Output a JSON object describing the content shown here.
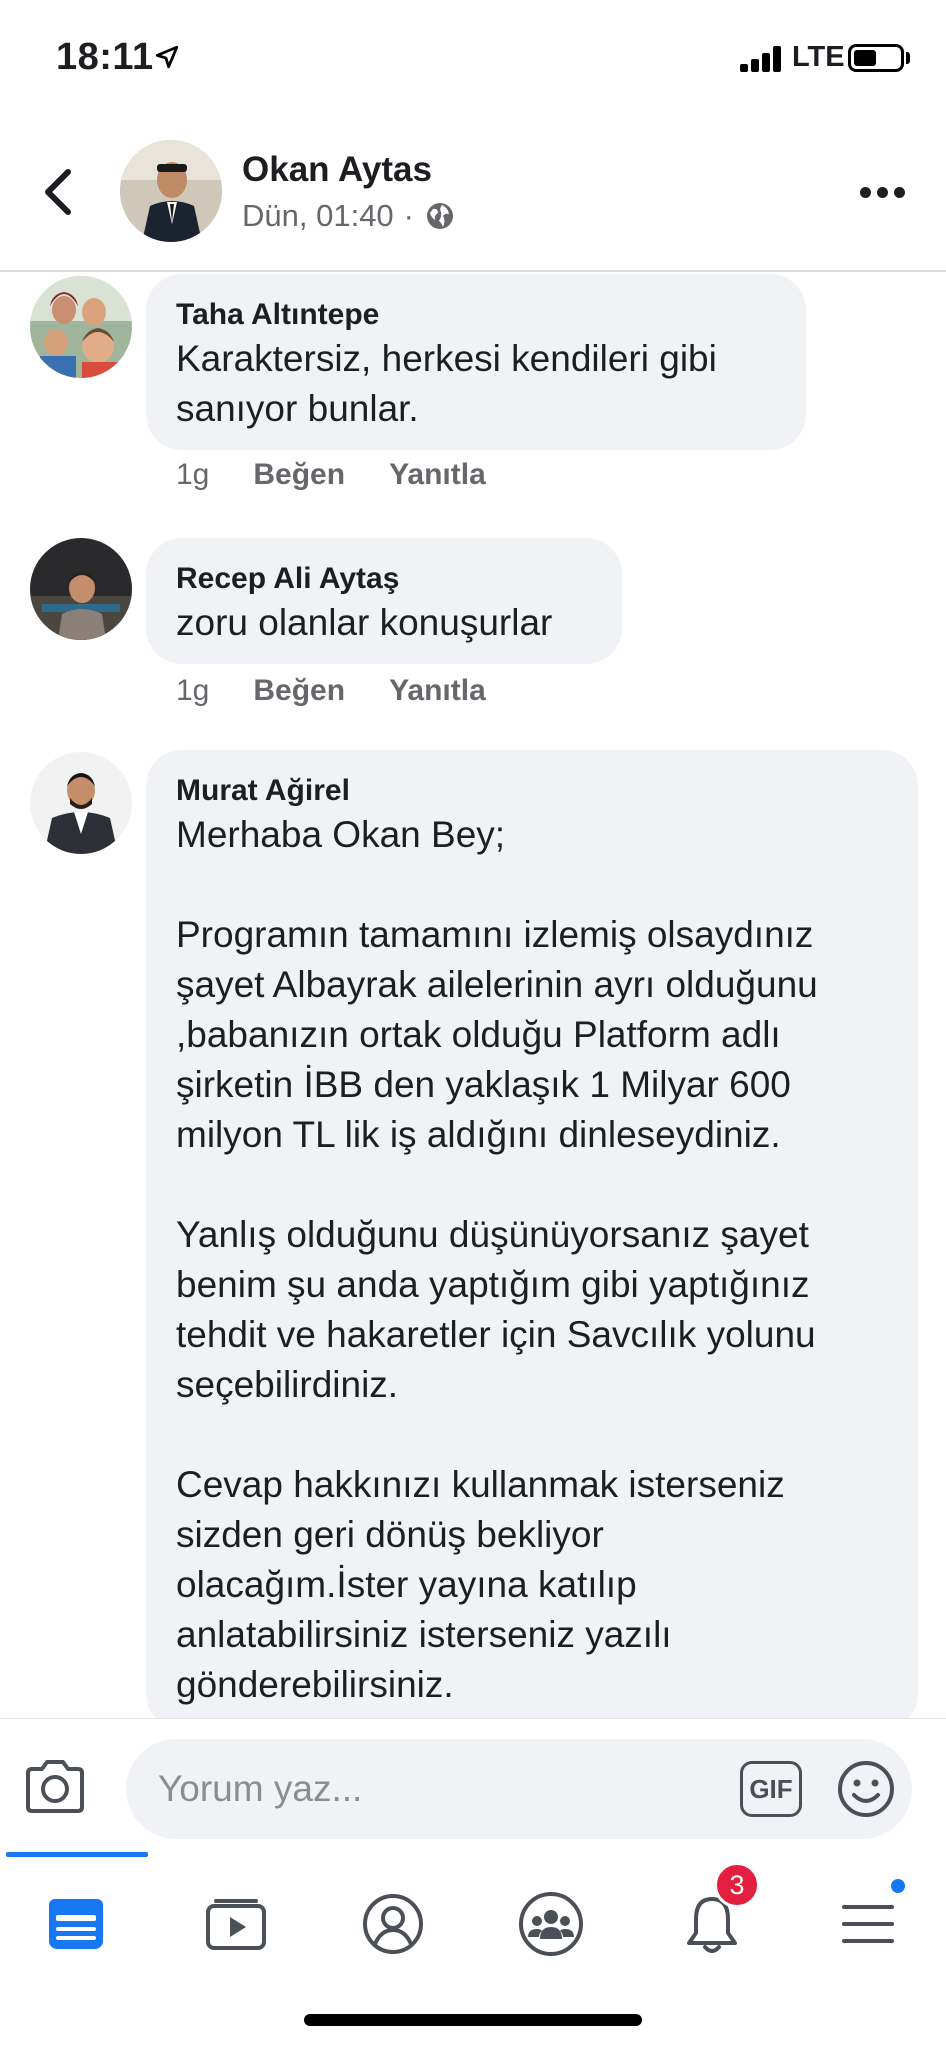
{
  "status_bar": {
    "time": "18:11",
    "network": "LTE"
  },
  "header": {
    "name": "Okan Aytas",
    "timestamp": "Dün, 01:40",
    "separator": "·",
    "privacy_icon": "globe-icon"
  },
  "comments": [
    {
      "author": "Taha Altıntepe",
      "text": "Karaktersiz, herkesi kendileri gibi\nsanıyor bunlar.",
      "age": "1g",
      "like": "Beğen",
      "reply": "Yanıtla"
    },
    {
      "author": "Recep Ali Aytaş",
      "text": "zoru olanlar konuşurlar",
      "age": "1g",
      "like": "Beğen",
      "reply": "Yanıtla"
    },
    {
      "author": "Murat Ağirel",
      "text": "Merhaba Okan Bey;\n\nProgramın tamamını izlemiş olsaydınız\nşayet Albayrak ailelerinin ayrı olduğunu\n,babanızın ortak olduğu Platform adlı\nşirketin İBB den yaklaşık 1 Milyar 600\nmilyon TL lik iş aldığını dinleseydiniz.\n\nYanlış olduğunu düşünüyorsanız şayet\nbenim şu anda yaptığım gibi yaptığınız\ntehdit ve hakaretler için Savcılık yolunu\nseçebilirdiniz.\n\nCevap hakkınızı kullanmak isterseniz\nsizden geri dönüş bekliyor\nolacağım.İster yayına katılıp\nanlatabilirsiniz isterseniz yazılı\ngönderebilirsiniz."
    }
  ],
  "composer": {
    "placeholder": "Yorum yaz...",
    "gif_label": "GIF"
  },
  "tab_bar": {
    "items": [
      "news-feed-icon",
      "watch-icon",
      "profile-icon",
      "groups-icon",
      "notifications-icon",
      "menu-icon"
    ],
    "notifications_count": "3"
  },
  "colors": {
    "accent": "#1877f2",
    "badge": "#e41e3f",
    "bubble": "#f0f2f5",
    "secondary_text": "#65676b"
  }
}
